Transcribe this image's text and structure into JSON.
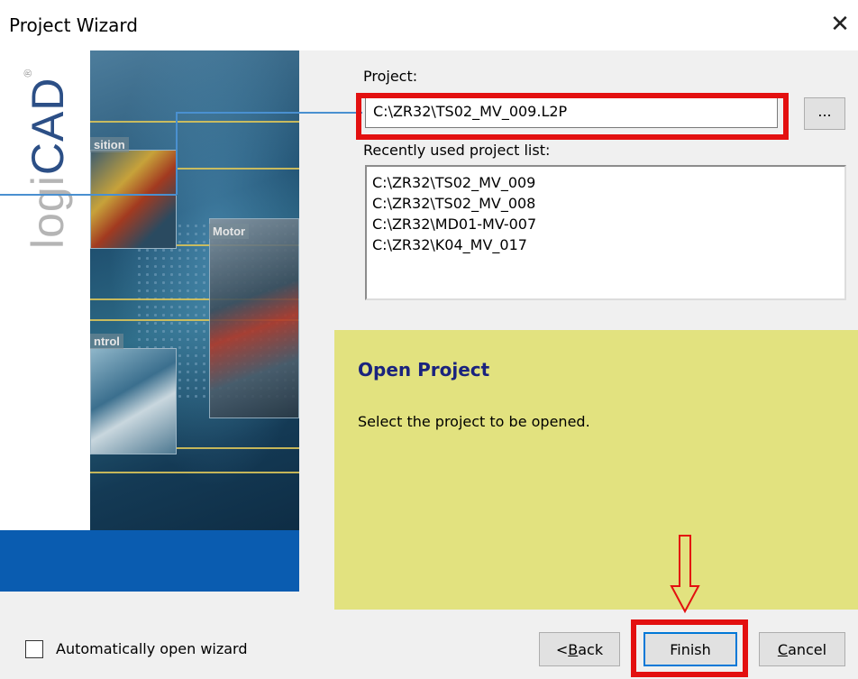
{
  "window": {
    "title": "Project Wizard",
    "close_glyph": "✕"
  },
  "banner": {
    "logo_prefix": "logi",
    "logo_suffix": "CAD",
    "logo_reg": "®",
    "labels": {
      "position": "sition",
      "motor": "Motor",
      "control": "ntrol"
    }
  },
  "project": {
    "label": "Project:",
    "value": "C:\\ZR32\\TS02_MV_009.L2P",
    "browse_label": "...",
    "recent_label": "Recently used project list:",
    "recent_items": [
      "C:\\ZR32\\TS02_MV_009",
      "C:\\ZR32\\TS02_MV_008",
      "C:\\ZR32\\MD01-MV-007",
      "C:\\ZR32\\K04_MV_017"
    ]
  },
  "info": {
    "title": "Open Project",
    "description": "Select the project to be opened.",
    "background": "#e2e27f",
    "title_color": "#1a237e"
  },
  "footer": {
    "auto_open_label": "Automatically open wizard",
    "auto_open_checked": false,
    "back_prefix": "< ",
    "back_accel": "B",
    "back_rest": "ack",
    "finish_label": "Finish",
    "cancel_accel": "C",
    "cancel_rest": "ancel"
  },
  "annotation_colors": {
    "highlight": "#e31010",
    "banner_blue": "#0a5cb0"
  }
}
